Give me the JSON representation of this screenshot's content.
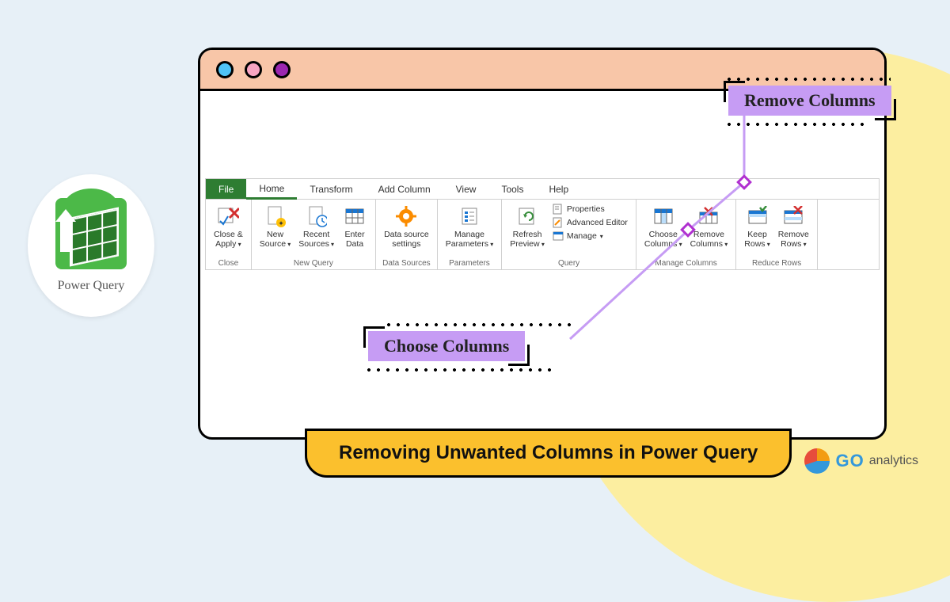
{
  "logo": {
    "label": "Power Query"
  },
  "tabs": [
    {
      "label": "File"
    },
    {
      "label": "Home"
    },
    {
      "label": "Transform"
    },
    {
      "label": "Add Column"
    },
    {
      "label": "View"
    },
    {
      "label": "Tools"
    },
    {
      "label": "Help"
    }
  ],
  "groups": {
    "close": {
      "label": "Close",
      "items": {
        "close_apply": "Close &\nApply"
      }
    },
    "new_query": {
      "label": "New Query",
      "new_source": "New\nSource",
      "recent_sources": "Recent\nSources",
      "enter_data": "Enter\nData"
    },
    "data_sources": {
      "label": "Data Sources",
      "data_source_settings": "Data source\nsettings"
    },
    "parameters": {
      "label": "Parameters",
      "manage_parameters": "Manage\nParameters"
    },
    "query": {
      "label": "Query",
      "refresh_preview": "Refresh\nPreview",
      "properties": "Properties",
      "advanced_editor": "Advanced Editor",
      "manage": "Manage"
    },
    "manage_columns": {
      "label": "Manage Columns",
      "choose_columns": "Choose\nColumns",
      "remove_columns": "Remove\nColumns"
    },
    "reduce_rows": {
      "label": "Reduce Rows",
      "keep_rows": "Keep\nRows",
      "remove_rows": "Remove\nRows"
    }
  },
  "callouts": {
    "remove": "Remove Columns",
    "choose": "Choose Columns"
  },
  "banner": "Removing Unwanted Columns in Power Query",
  "brand": {
    "go": "GO",
    "analytics": "analytics"
  },
  "colors": {
    "accent_green": "#2e7d32",
    "callout_purple": "#c69cf4",
    "banner_yellow": "#fbc02d",
    "titlebar_peach": "#f8c6a8"
  }
}
